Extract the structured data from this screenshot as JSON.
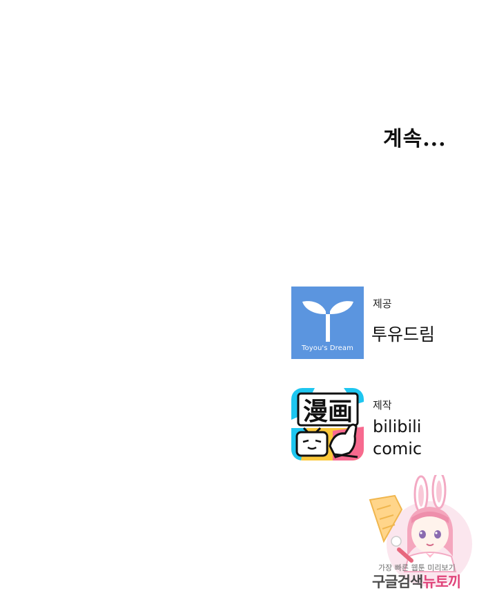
{
  "continued_text": "계속...",
  "credits": {
    "provider": {
      "role": "제공",
      "name": "투유드림",
      "logo_text": "Toyou's Dream",
      "logo_color": "#5b95df",
      "logo_icon": "sprout-t-icon"
    },
    "producer": {
      "role": "제작",
      "name_line1": "bilibili",
      "name_line2": "comic",
      "logo_text": "漫画",
      "logo_icon": "bilibili-tv-icon",
      "accent_colors": [
        "#1ec6f0",
        "#fbc83a",
        "#f76a8f"
      ]
    }
  },
  "watermark": {
    "caption": "가장 빠른 웹툰 미리보기",
    "title_dark": "구글검색",
    "title_accent": "뉴토끼",
    "accent_color": "#e0457b",
    "icon": "bunny-girl-mascot-icon"
  }
}
